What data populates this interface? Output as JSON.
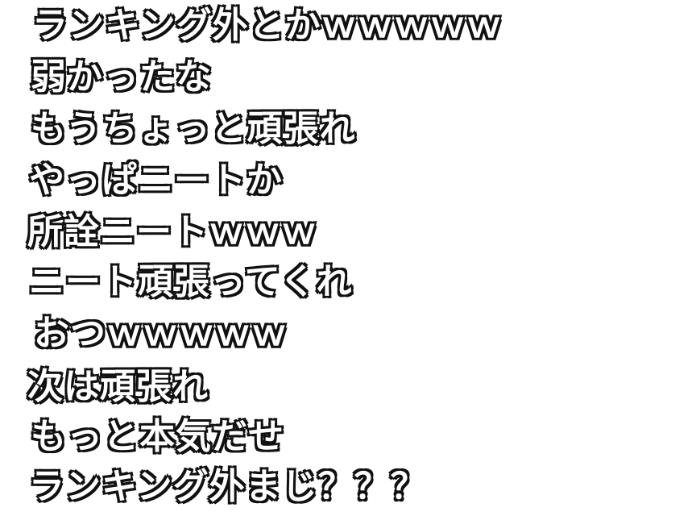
{
  "comments": [
    "ランキング外とかｗｗｗｗｗ",
    "弱かったな",
    "もうちょっと頑張れ",
    "やっぱニートか",
    "所詮ニートｗｗｗ",
    "ニート頑張ってくれ",
    "おつｗｗｗｗｗ",
    "次は頑張れ",
    "もっと本気だせ",
    "ランキング外まじ？？？"
  ],
  "colors": {
    "text_fill": "#ffffff",
    "text_outline": "#111111",
    "background": "#ffffff"
  }
}
